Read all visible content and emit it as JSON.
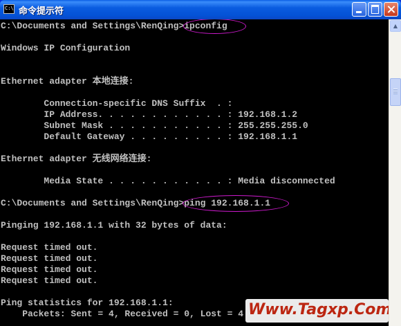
{
  "window": {
    "title": "命令提示符",
    "icon": "cmd-icon",
    "icon_text": "C:\\"
  },
  "console": {
    "lines": [
      "C:\\Documents and Settings\\RenQing>ipconfig",
      "",
      "Windows IP Configuration",
      "",
      "",
      "Ethernet adapter 本地连接:",
      "",
      "        Connection-specific DNS Suffix  . :",
      "        IP Address. . . . . . . . . . . . : 192.168.1.2",
      "        Subnet Mask . . . . . . . . . . . : 255.255.255.0",
      "        Default Gateway . . . . . . . . . : 192.168.1.1",
      "",
      "Ethernet adapter 无线网络连接:",
      "",
      "        Media State . . . . . . . . . . . : Media disconnected",
      "",
      "C:\\Documents and Settings\\RenQing>ping 192.168.1.1",
      "",
      "Pinging 192.168.1.1 with 32 bytes of data:",
      "",
      "Request timed out.",
      "Request timed out.",
      "Request timed out.",
      "Request timed out.",
      "",
      "Ping statistics for 192.168.1.1:",
      "    Packets: Sent = 4, Received = 0, Lost = 4"
    ]
  },
  "watermark": {
    "text": "Www.Tagxp.Com"
  },
  "colors": {
    "console_bg": "#000000",
    "console_text": "#c0c0c0",
    "highlight_ellipse": "#d01ad0",
    "titlebar": "#0a5ce0",
    "watermark_text": "#cc2a14"
  }
}
